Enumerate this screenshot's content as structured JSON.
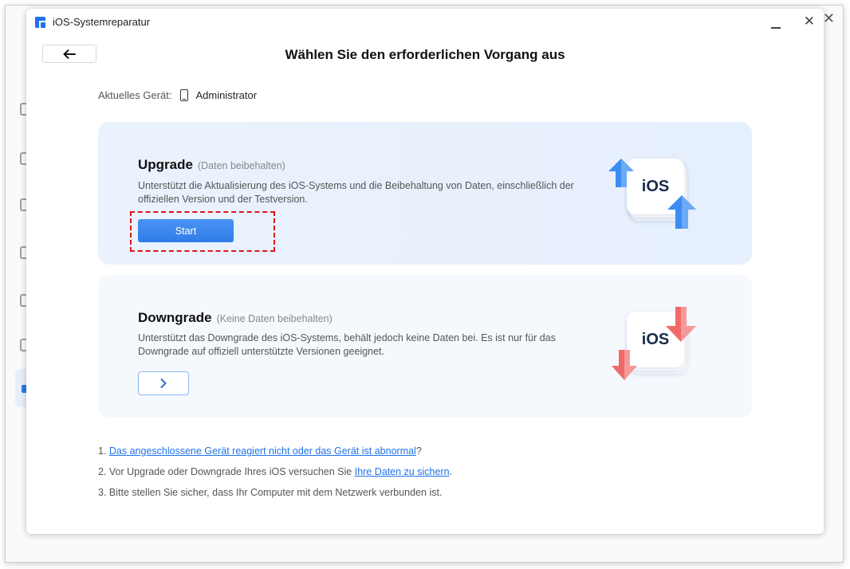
{
  "window": {
    "title": "iOS-Systemreparatur"
  },
  "header": {
    "title": "Wählen Sie den erforderlichen Vorgang aus"
  },
  "device": {
    "label": "Aktuelles Gerät:",
    "name": "Administrator"
  },
  "options": {
    "upgrade": {
      "title": "Upgrade",
      "subtitle": "(Daten beibehalten)",
      "description": "Unterstützt die Aktualisierung des iOS-Systems und die Beibehaltung von Daten, einschließlich der offiziellen Version und der Testversion.",
      "button_label": "Start",
      "illustration_text": "iOS"
    },
    "downgrade": {
      "title": "Downgrade",
      "subtitle": "(Keine Daten beibehalten)",
      "description": "Unterstützt das Downgrade des iOS-Systems, behält jedoch keine Daten bei. Es ist nur für das Downgrade auf offiziell unterstützte Versionen geeignet.",
      "illustration_text": "iOS"
    }
  },
  "notes": {
    "n1_prefix": "1. ",
    "n1_link": "Das angeschlossene Gerät reagiert nicht oder das Gerät ist abnormal",
    "n1_suffix": "?",
    "n2_prefix": "2. Vor Upgrade oder Downgrade Ihres iOS versuchen Sie ",
    "n2_link": "Ihre Daten zu sichern",
    "n2_suffix": ".",
    "n3": "3. Bitte stellen Sie sicher, dass Ihr Computer mit dem Netzwerk verbunden ist."
  },
  "colors": {
    "accent": "#2f7ce9",
    "link": "#1f73e8",
    "highlight": "#e0141e",
    "up_arrow": "#3b8df2",
    "down_arrow": "#f26a6a"
  },
  "icons": {
    "back": "arrow-left-icon",
    "next": "chevron-right-icon",
    "device": "phone-icon",
    "close": "close-icon",
    "minimize": "minimize-icon"
  }
}
